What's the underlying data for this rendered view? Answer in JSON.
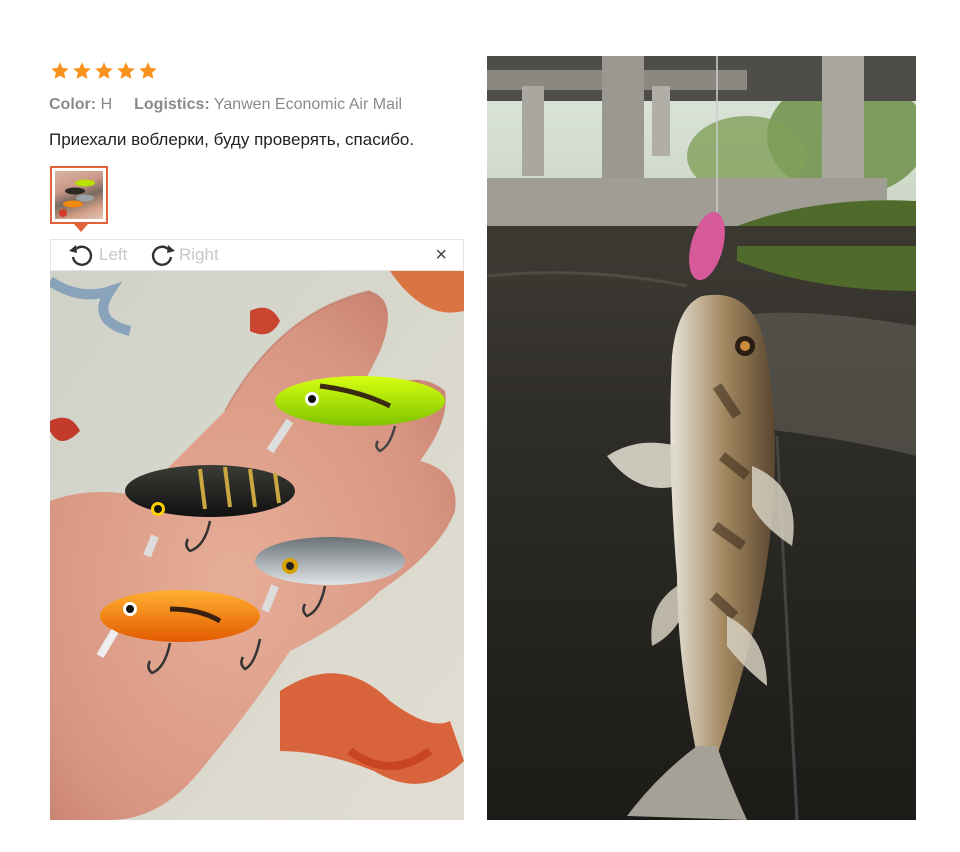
{
  "rating": {
    "stars": 5,
    "max": 5,
    "color": "#f7931e"
  },
  "meta": {
    "color_label": "Color:",
    "color_value": "H",
    "logistics_label": "Logistics:",
    "logistics_value": "Yanwen Economic Air Mail"
  },
  "review_text": "Приехали воблерки, буду проверять, спасибо.",
  "toolbar": {
    "rotate_left_label": "Left",
    "rotate_right_label": "Right",
    "close_label": "×"
  },
  "colors": {
    "accent": "#e2623b",
    "muted": "#c8c8c8"
  }
}
